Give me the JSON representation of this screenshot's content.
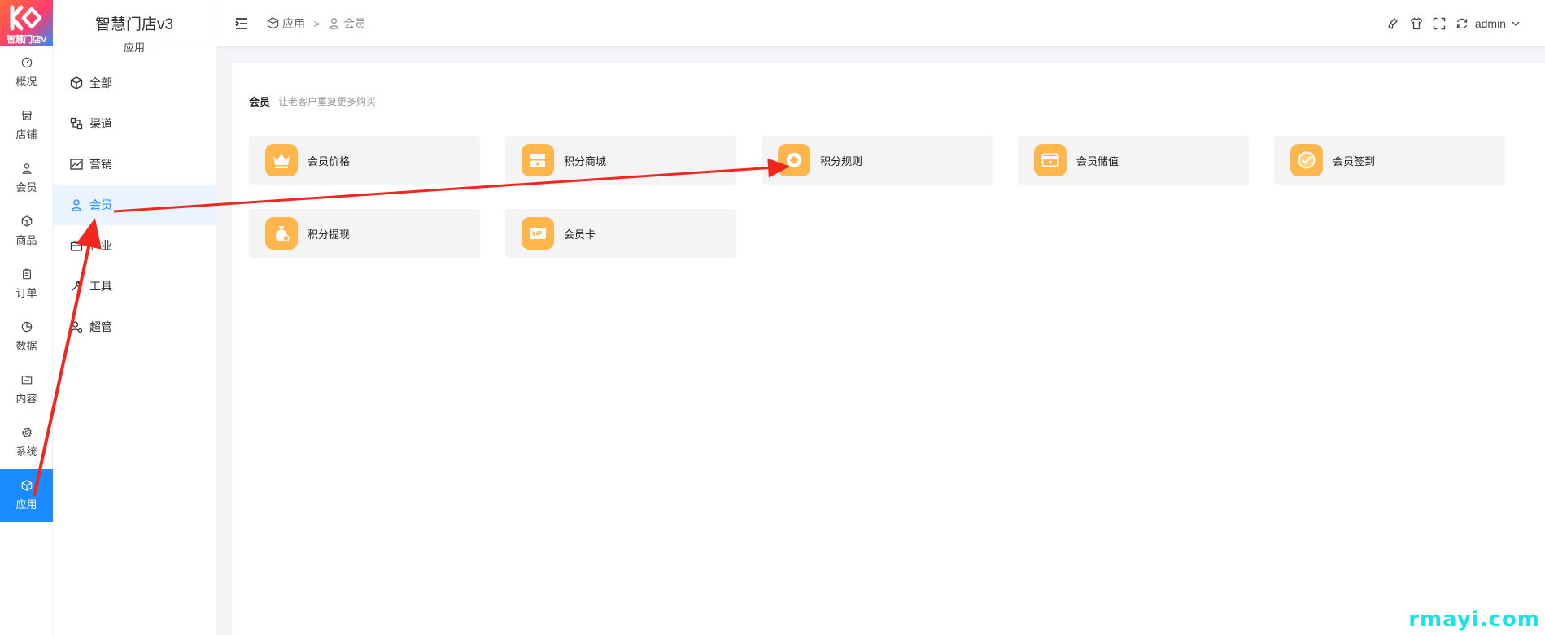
{
  "app": {
    "logo_text": "智慧门店V",
    "title": "智慧门店v3",
    "section": "应用"
  },
  "rail": [
    {
      "label": "概况",
      "icon": "dashboard-icon"
    },
    {
      "label": "店铺",
      "icon": "store-icon"
    },
    {
      "label": "会员",
      "icon": "user-icon"
    },
    {
      "label": "商品",
      "icon": "box-icon"
    },
    {
      "label": "订单",
      "icon": "clipboard-icon"
    },
    {
      "label": "数据",
      "icon": "pie-icon"
    },
    {
      "label": "内容",
      "icon": "folder-icon"
    },
    {
      "label": "系统",
      "icon": "gear-icon"
    },
    {
      "label": "应用",
      "icon": "cube-icon",
      "active": true
    }
  ],
  "subnav": [
    {
      "label": "全部",
      "icon": "cube-icon"
    },
    {
      "label": "渠道",
      "icon": "channel-icon"
    },
    {
      "label": "营销",
      "icon": "chart-icon"
    },
    {
      "label": "会员",
      "icon": "user-icon",
      "active": true
    },
    {
      "label": "行业",
      "icon": "briefcase-icon"
    },
    {
      "label": "工具",
      "icon": "tool-icon"
    },
    {
      "label": "超管",
      "icon": "admin-icon"
    }
  ],
  "breadcrumb": {
    "root": "应用",
    "separator": ">",
    "current": "会员"
  },
  "user": {
    "name": "admin"
  },
  "section": {
    "title": "会员",
    "desc": "让老客户重复更多购买"
  },
  "tiles": [
    {
      "label": "会员价格",
      "icon": "crown-icon"
    },
    {
      "label": "积分商城",
      "icon": "shop-icon"
    },
    {
      "label": "积分规则",
      "icon": "coin-icon"
    },
    {
      "label": "会员储值",
      "icon": "card-icon"
    },
    {
      "label": "会员签到",
      "icon": "signin-icon"
    },
    {
      "label": "积分提现",
      "icon": "moneybag-icon"
    },
    {
      "label": "会员卡",
      "icon": "vip-card-icon"
    }
  ],
  "watermark": "rmayi.com",
  "colors": {
    "accent": "#1b8cff",
    "tile_icon_bg": "#ffb64d",
    "annotation_arrow": "#f0271f",
    "watermark": "#1de3e0"
  }
}
